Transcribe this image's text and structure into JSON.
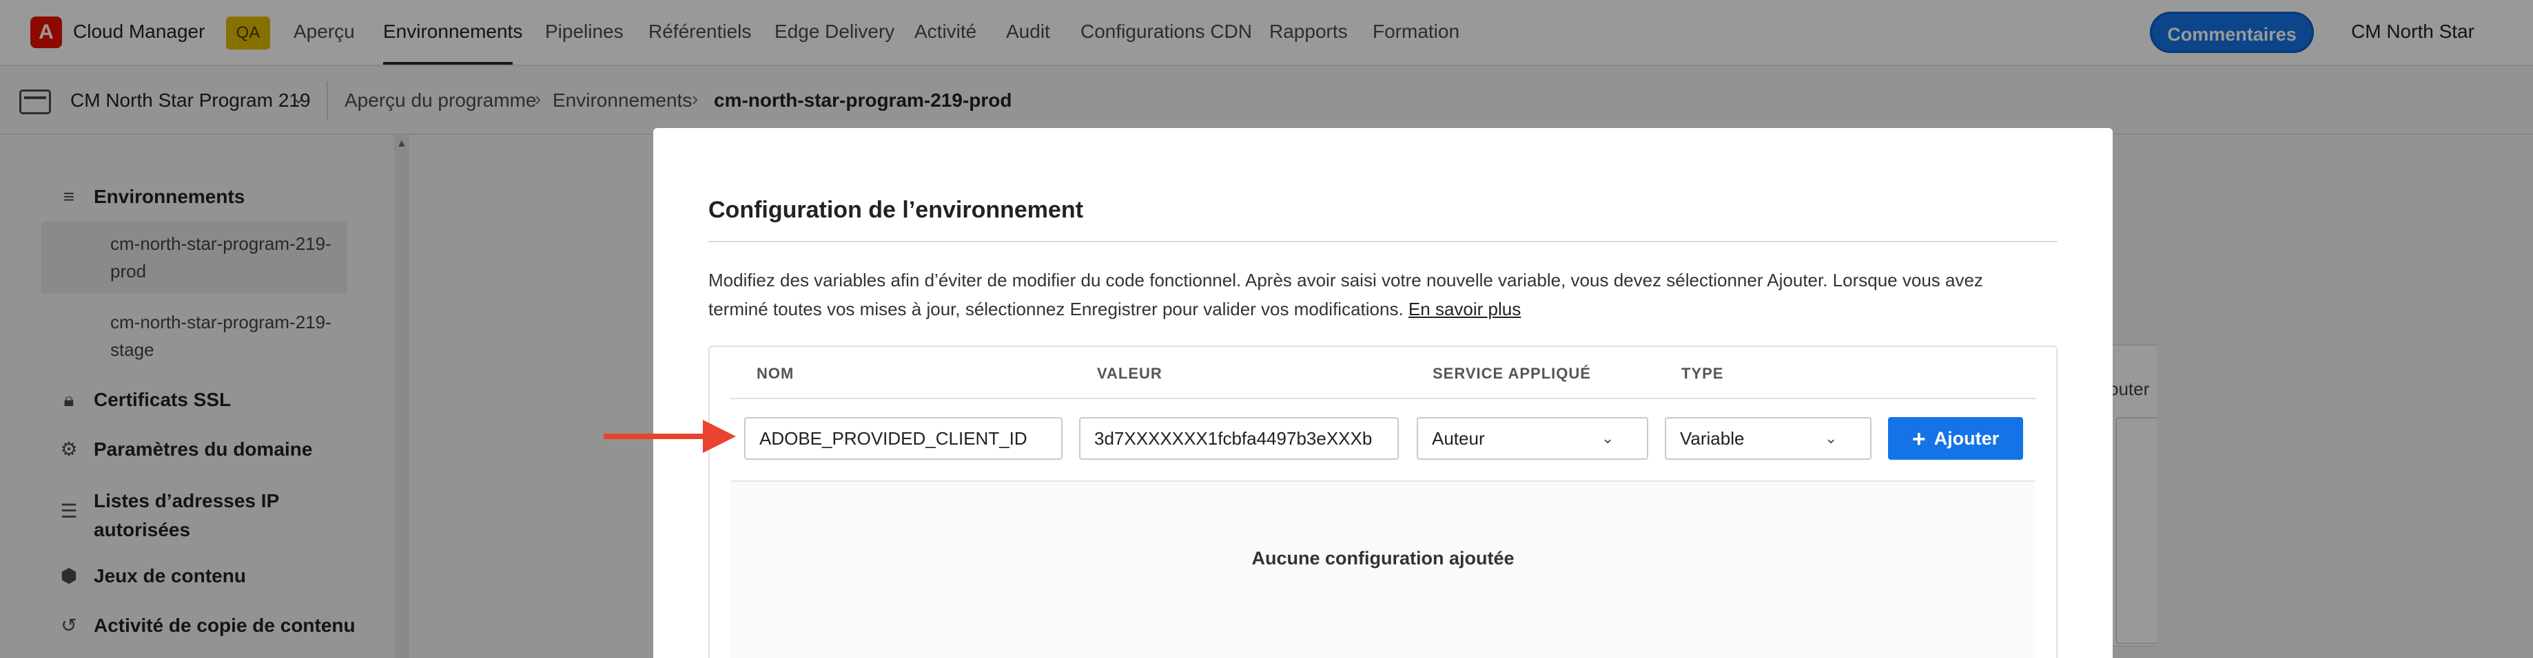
{
  "header": {
    "logo_letter": "A",
    "app_name": "Cloud Manager",
    "env_badge": "QA",
    "nav": [
      "Aperçu",
      "Environnements",
      "Pipelines",
      "Référentiels",
      "Edge Delivery",
      "Activité",
      "Audit",
      "Configurations CDN",
      "Rapports",
      "Formation"
    ],
    "active_nav": "Environnements",
    "feedback_label": "Commentaires",
    "org_name": "CM North Star"
  },
  "breadcrumb": {
    "program": "CM North Star Program 219",
    "items": [
      "Aperçu du programme",
      "Environnements",
      "cm-north-star-program-219-prod"
    ]
  },
  "sidebar": {
    "section_title": "Environnements",
    "environments": [
      {
        "label": "cm-north-star-program-219-prod",
        "selected": true
      },
      {
        "label": "cm-north-star-program-219-stage",
        "selected": false
      }
    ],
    "items": [
      {
        "label": "Certificats SSL",
        "icon": "lock-icon"
      },
      {
        "label": "Paramètres du domaine",
        "icon": "gear-icon"
      },
      {
        "label": "Listes d’adresses IP autorisées",
        "icon": "list-icon"
      },
      {
        "label": "Jeux de contenu",
        "icon": "cube-icon"
      },
      {
        "label": "Activité de copie de contenu",
        "icon": "history-icon"
      }
    ]
  },
  "background": {
    "card_text": "outer"
  },
  "dialog": {
    "title": "Configuration de l’environnement",
    "description": "Modifiez des variables afin d’éviter de modifier du code fonctionnel. Après avoir saisi votre nouvelle variable, vous devez sélectionner Ajouter. Lorsque vous avez terminé toutes vos mises à jour, sélectionnez Enregistrer pour valider vos modifications.",
    "learn_more": "En savoir plus",
    "table": {
      "headers": [
        "NOM",
        "VALEUR",
        "SERVICE APPLIQUÉ",
        "TYPE"
      ],
      "name_value": "ADOBE_PROVIDED_CLIENT_ID",
      "value_value": "3d7XXXXXXX1fcbfa4497b3eXXXb",
      "service_selected": "Auteur",
      "type_selected": "Variable",
      "add_label": "Ajouter",
      "empty_message": "Aucune configuration ajoutée"
    }
  },
  "colors": {
    "accent_blue": "#1473e6",
    "adobe_red": "#eb1000",
    "qa_badge": "#e0bd00",
    "annotation_arrow": "#e8432e"
  }
}
